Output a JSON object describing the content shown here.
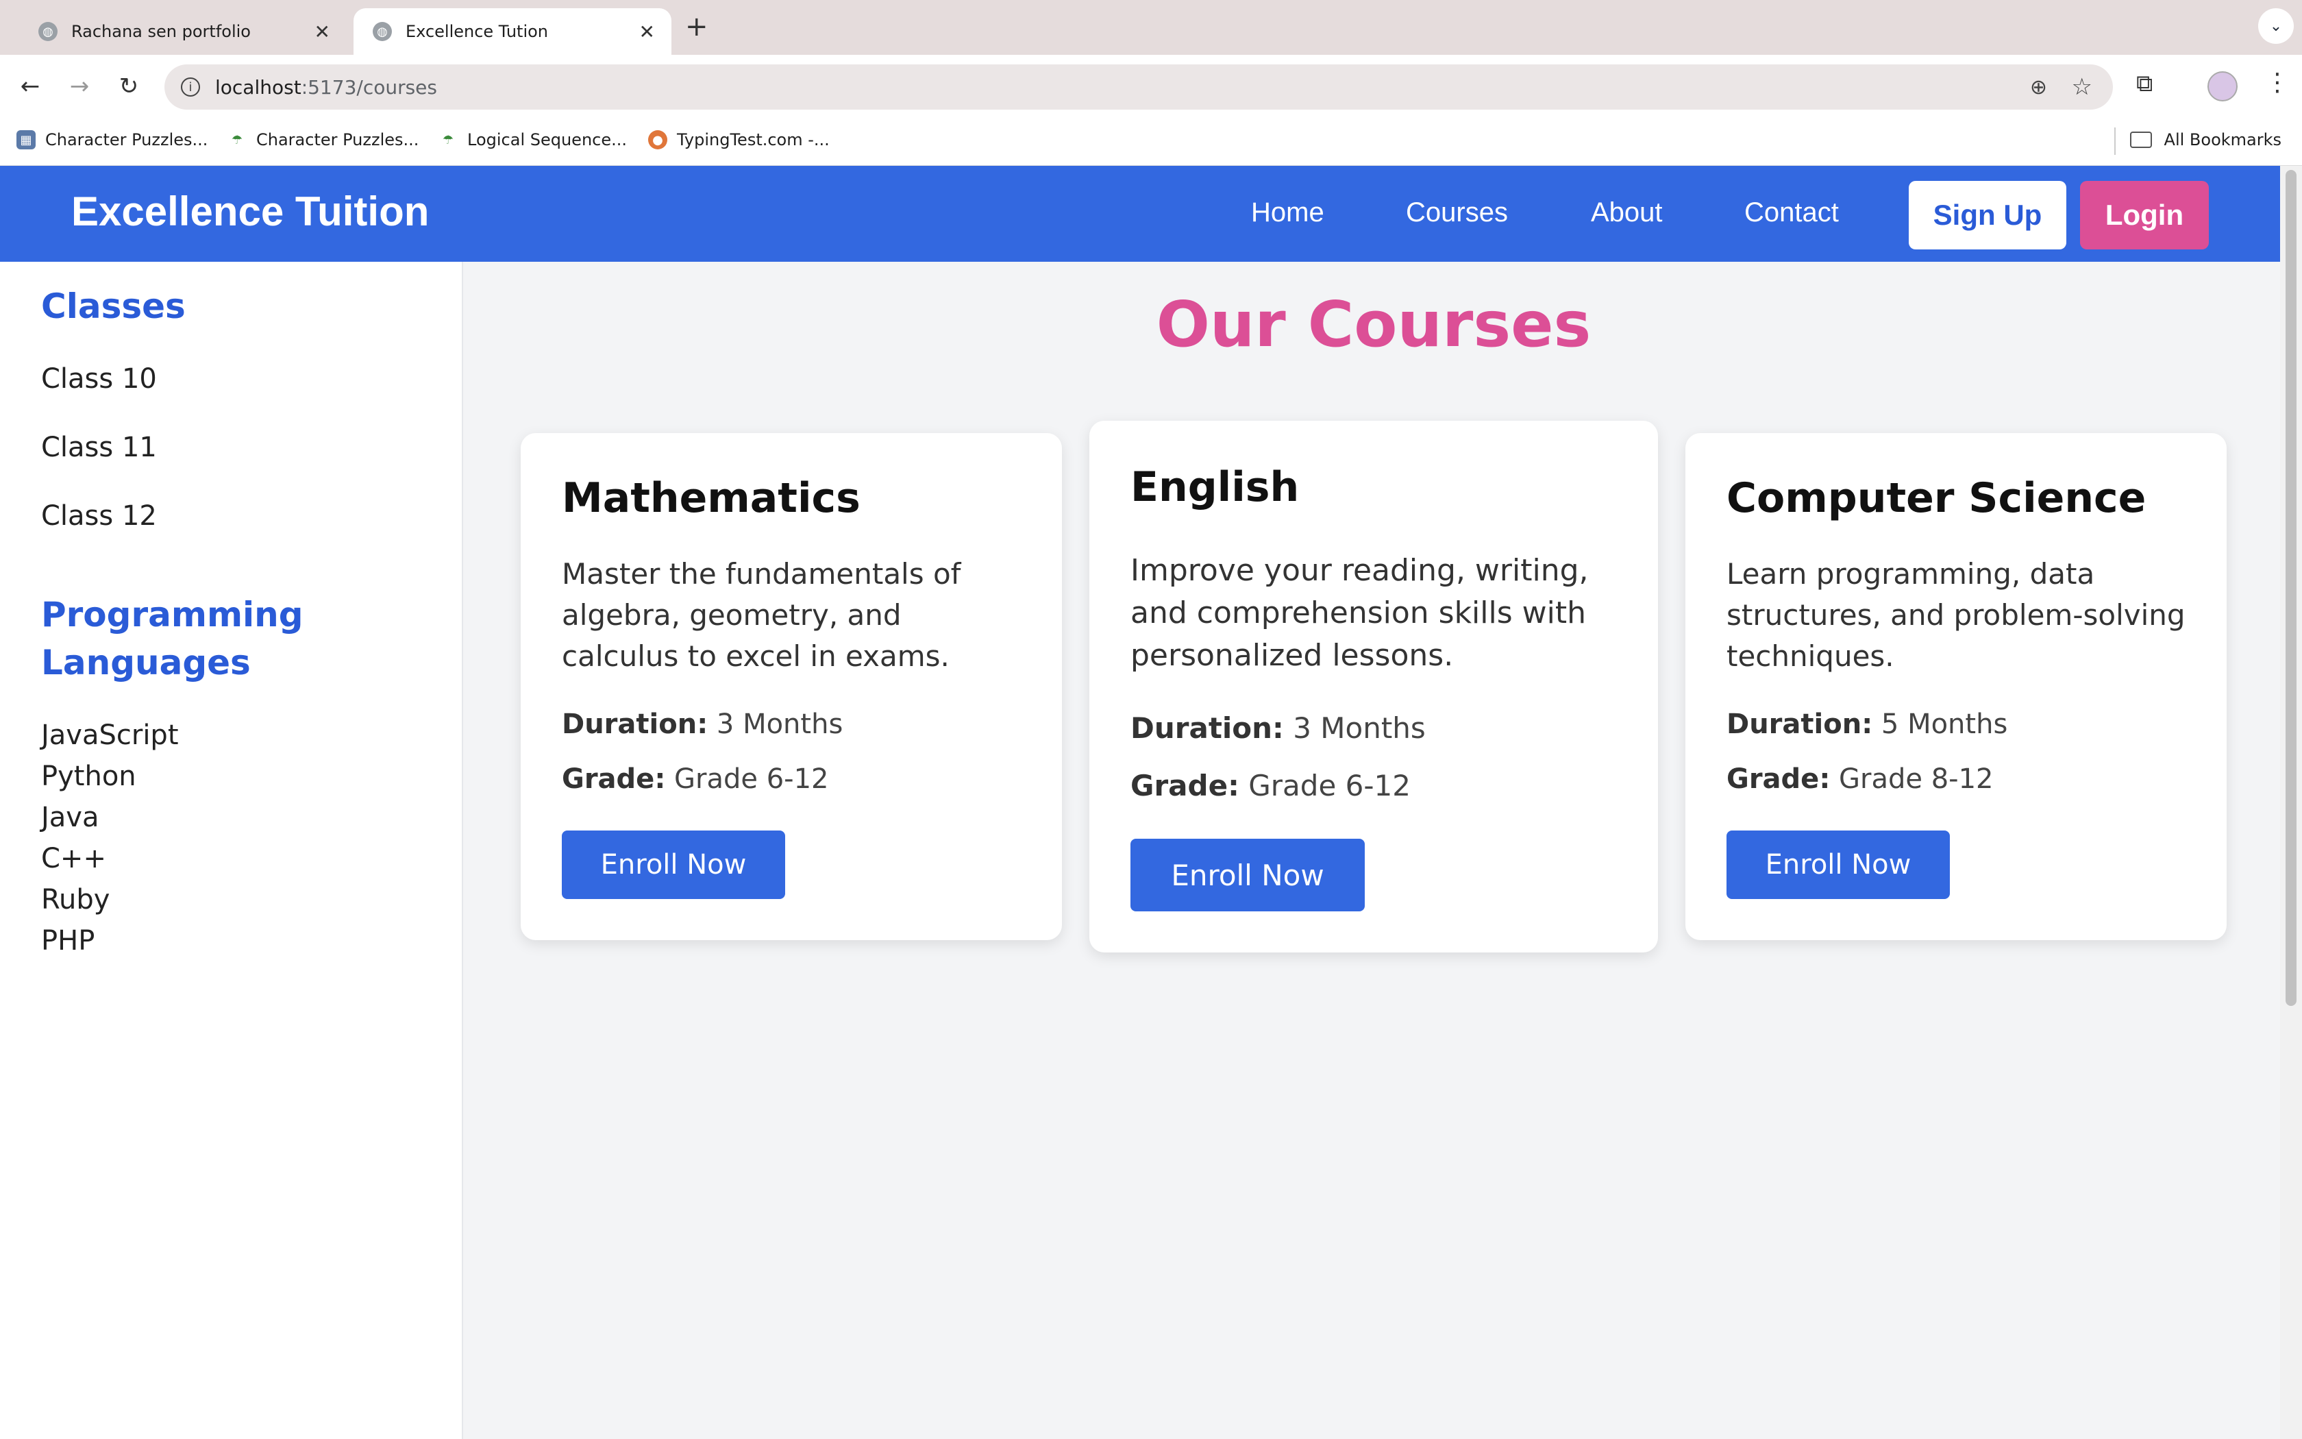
{
  "browser": {
    "tabs": [
      {
        "title": "Rachana sen portfolio",
        "active": false
      },
      {
        "title": "Excellence Tution",
        "active": true
      }
    ],
    "url_host": "localhost",
    "url_path": ":5173/courses",
    "bookmarks": [
      "Character Puzzles...",
      "Character Puzzles...",
      "Logical Sequence...",
      "TypingTest.com -..."
    ],
    "all_bookmarks": "All Bookmarks"
  },
  "navbar": {
    "brand": "Excellence Tuition",
    "links": [
      "Home",
      "Courses",
      "About",
      "Contact"
    ],
    "signup": "Sign Up",
    "login": "Login",
    "color": "#3368e0",
    "login_color": "#dc4f96"
  },
  "sidebar": {
    "classes_heading": "Classes",
    "classes": [
      "Class 10",
      "Class 11",
      "Class 12"
    ],
    "prog_heading_line1": "Programming",
    "prog_heading_line2": "Languages",
    "languages": [
      "JavaScript",
      "Python",
      "Java",
      "C++",
      "Ruby",
      "PHP"
    ]
  },
  "main": {
    "title": "Our Courses",
    "duration_label": "Duration:",
    "grade_label": "Grade:",
    "courses": [
      {
        "title": "Mathematics",
        "description": "Master the fundamentals of algebra, geometry, and calculus to excel in exams.",
        "duration": "3 Months",
        "grade": "Grade 6-12",
        "button": "Enroll Now"
      },
      {
        "title": "English",
        "description": "Improve your reading, writing, and comprehension skills with personalized lessons.",
        "duration": "3 Months",
        "grade": "Grade 6-12",
        "button": "Enroll Now"
      },
      {
        "title": "Computer Science",
        "description": "Learn programming, data structures, and problem-solving techniques.",
        "duration": "5 Months",
        "grade": "Grade 8-12",
        "button": "Enroll Now"
      }
    ]
  }
}
